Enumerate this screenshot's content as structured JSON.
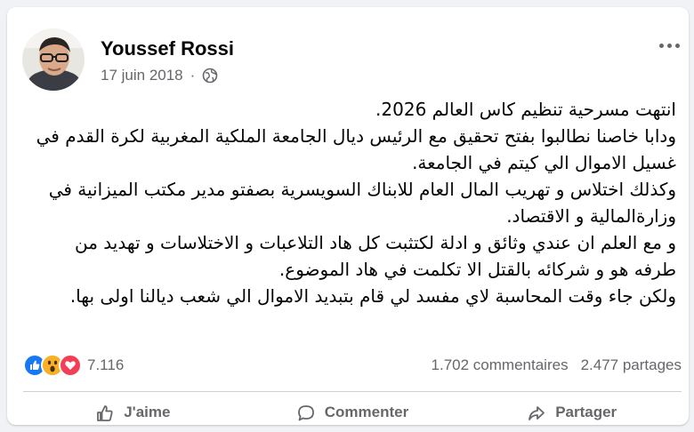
{
  "post": {
    "author": "Youssef Rossi",
    "date": "17 juin 2018",
    "separator": "·",
    "audience_icon": "globe-icon",
    "paragraphs": [
      "انتهت مسرحية تنظيم كاس العالم 2026.",
      "ودابا خاصنا نطالبوا بفتح تحقيق مع الرئيس ديال الجامعة الملكية المغربية لكرة القدم في غسيل الاموال الي كيتم في الجامعة.",
      "وكذلك اختلاس و تهريب المال العام للابناك السويسرية بصفتو مدير مكتب الميزانية في وزارةالمالية و الاقتصاد.",
      "و مع العلم ان عندي وثائق و ادلة لكتثبت كل هاد التلاعبات و الاختلاسات و تهديد من طرفه هو و شركائه بالقتل الا تكلمت في هاد الموضوع.",
      "ولكن جاء وقت المحاسبة لاي مفسد لي قام بتبديد الاموال الي شعب ديالنا اولى بها."
    ]
  },
  "stats": {
    "reactions": [
      "like-icon",
      "wow-icon",
      "love-icon"
    ],
    "reaction_count": "7.116",
    "comments": "1.702 commentaires",
    "shares": "2.477 partages"
  },
  "actions": [
    {
      "icon": "thumbs-up-icon",
      "label": "J'aime"
    },
    {
      "icon": "comment-icon",
      "label": "Commenter"
    },
    {
      "icon": "share-icon",
      "label": "Partager"
    }
  ],
  "colors": {
    "like": "#1877f2",
    "love": "#f33e58",
    "wow": "#f7b125",
    "secondary_text": "#65676b"
  }
}
